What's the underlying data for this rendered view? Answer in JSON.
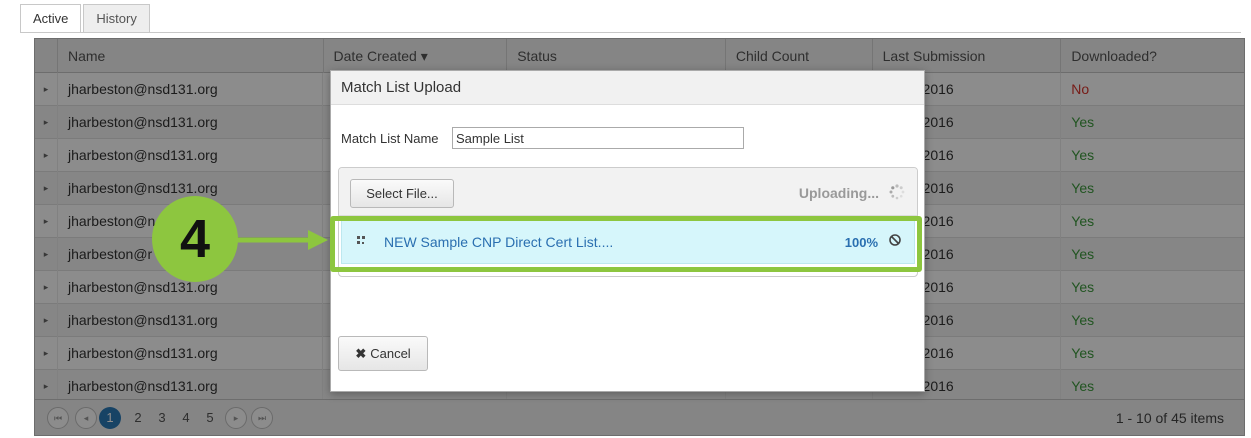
{
  "tabs": [
    {
      "label": "Active",
      "active": true
    },
    {
      "label": "History",
      "active": false
    }
  ],
  "grid": {
    "columns": [
      "Name",
      "Date Created ▾",
      "Status",
      "Child Count",
      "Last Submission",
      "Downloaded?"
    ],
    "rows": [
      {
        "name": "jharbeston@nsd131.org",
        "last": "2016",
        "downloaded": "No"
      },
      {
        "name": "jharbeston@nsd131.org",
        "last": "2016",
        "downloaded": "Yes"
      },
      {
        "name": "jharbeston@nsd131.org",
        "last": "2016",
        "downloaded": "Yes"
      },
      {
        "name": "jharbeston@nsd131.org",
        "last": "2016",
        "downloaded": "Yes"
      },
      {
        "name": "jharbeston@n",
        "last": "2016",
        "downloaded": "Yes"
      },
      {
        "name": "jharbeston@r",
        "last": "2016",
        "downloaded": "Yes"
      },
      {
        "name": "jharbeston@nsd131.org",
        "last": "2016",
        "downloaded": "Yes"
      },
      {
        "name": "jharbeston@nsd131.org",
        "last": "2016",
        "downloaded": "Yes"
      },
      {
        "name": "jharbeston@nsd131.org",
        "last": "2016",
        "downloaded": "Yes"
      },
      {
        "name": "jharbeston@nsd131.org",
        "last": "2016",
        "downloaded": "Yes"
      }
    ],
    "expand_icon": "▸"
  },
  "pager": {
    "first": "⏮",
    "prev": "◂",
    "pages": [
      "1",
      "2",
      "3",
      "4",
      "5"
    ],
    "active_page": "1",
    "next": "▸",
    "last": "⏭",
    "info": "1 - 10 of 45 items"
  },
  "modal": {
    "title": "Match List Upload",
    "list_name_label": "Match List Name",
    "list_name_value": "Sample List",
    "select_file_label": "Select File...",
    "status_text": "Uploading...",
    "file": {
      "name": "NEW Sample CNP Direct Cert List....",
      "progress": "100%"
    },
    "cancel_label": "Cancel"
  },
  "annotation": {
    "step": "4",
    "color": "#8dc63f"
  },
  "colors": {
    "no": "#d9342b",
    "yes": "#3c9a3c",
    "accent": "#2a7ab8",
    "file_row_bg": "#d6f6fb"
  }
}
